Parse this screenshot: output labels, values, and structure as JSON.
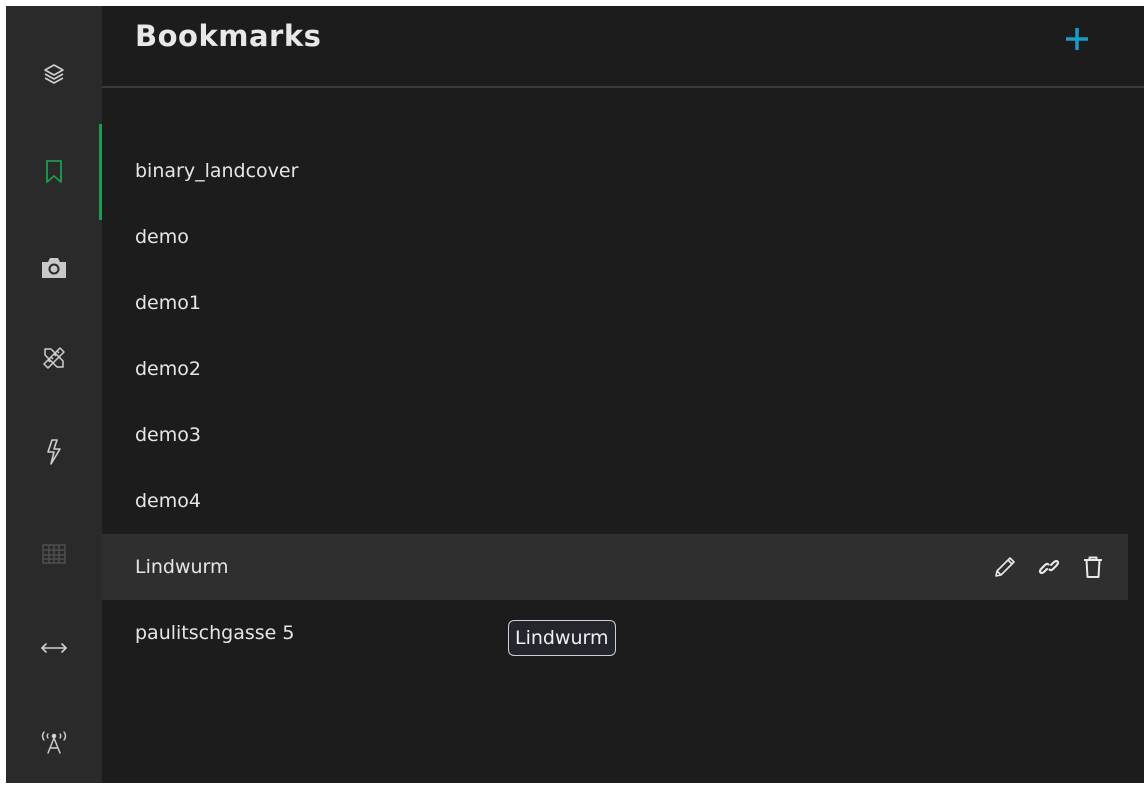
{
  "panel": {
    "title": "Bookmarks",
    "add_icon": "plus-icon",
    "accent_color": "#1a9cc4"
  },
  "sidebar": {
    "active_color": "#1e9b50",
    "items": [
      {
        "icon": "layers-icon"
      },
      {
        "icon": "bookmark-icon",
        "active": true
      },
      {
        "icon": "camera-icon"
      },
      {
        "icon": "ruler-pencil-icon"
      },
      {
        "icon": "lightning-icon"
      },
      {
        "icon": "grid-table-icon"
      },
      {
        "icon": "arrows-horizontal-icon"
      },
      {
        "icon": "broadcast-antenna-icon"
      }
    ]
  },
  "bookmarks": [
    {
      "label": "binary_landcover"
    },
    {
      "label": "demo"
    },
    {
      "label": "demo1"
    },
    {
      "label": "demo2"
    },
    {
      "label": "demo3"
    },
    {
      "label": "demo4"
    },
    {
      "label": "Lindwurm",
      "hovered": true,
      "actions": [
        "pencil-icon",
        "link-icon",
        "trash-icon"
      ]
    },
    {
      "label": "paulitschgasse 5"
    }
  ],
  "tooltip": {
    "text": "Lindwurm"
  }
}
